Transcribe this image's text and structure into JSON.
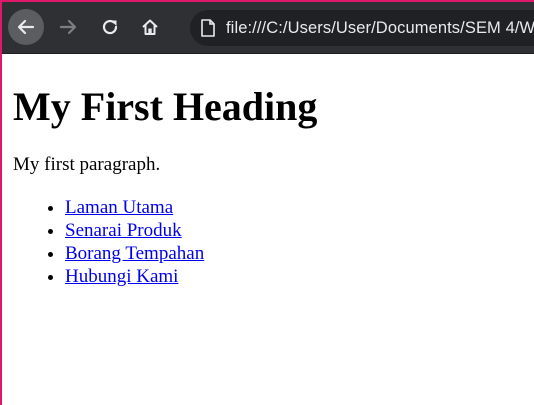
{
  "browser": {
    "url": "file:///C:/Users/User/Documents/SEM 4/W",
    "icons": {
      "back": "back-arrow-icon",
      "forward": "forward-arrow-icon",
      "reload": "reload-icon",
      "home": "home-icon",
      "page": "page-icon"
    },
    "colors": {
      "toolbar": "#2f3033",
      "omnibox": "#202124",
      "window_border": "#e0186c"
    }
  },
  "page": {
    "heading": "My First Heading",
    "paragraph": "My first paragraph.",
    "links": [
      {
        "label": "Laman Utama"
      },
      {
        "label": "Senarai Produk"
      },
      {
        "label": "Borang Tempahan"
      },
      {
        "label": "Hubungi Kami"
      }
    ],
    "link_color": "#0000ee"
  }
}
